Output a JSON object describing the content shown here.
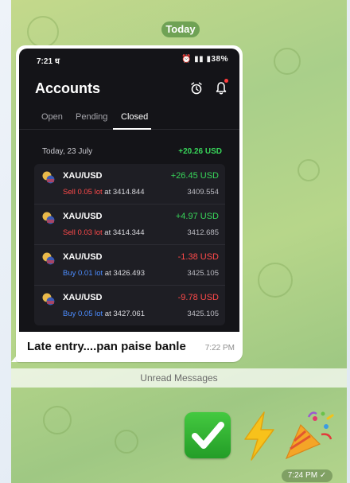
{
  "chat": {
    "date_label": "Today",
    "unread_label": "Unread Messages",
    "message": {
      "caption": "Late entry....pan paise banle",
      "time": "7:22 PM"
    },
    "emoji_message": {
      "emojis": [
        "check-mark-button",
        "high-voltage",
        "party-popper"
      ],
      "time": "7:24 PM",
      "status": "sent"
    }
  },
  "screenshot": {
    "status_bar": {
      "time": "7:21",
      "time_suffix": "ध",
      "battery": "38%"
    },
    "title": "Accounts",
    "tabs": [
      {
        "label": "Open",
        "active": false
      },
      {
        "label": "Pending",
        "active": false
      },
      {
        "label": "Closed",
        "active": true
      }
    ],
    "day": {
      "label": "Today, 23 July",
      "total": "+20.26 USD"
    },
    "trades": [
      {
        "symbol": "XAU/USD",
        "pnl": "+26.45 USD",
        "side": "Sell 0.05 lot",
        "at": " at 3414.844",
        "close": "3409.554",
        "sign": "pos"
      },
      {
        "symbol": "XAU/USD",
        "pnl": "+4.97 USD",
        "side": "Sell 0.03 lot",
        "at": " at 3414.344",
        "close": "3412.685",
        "sign": "pos"
      },
      {
        "symbol": "XAU/USD",
        "pnl": "-1.38 USD",
        "side": "Buy 0.01 lot",
        "at": " at 3426.493",
        "close": "3425.105",
        "sign": "neg"
      },
      {
        "symbol": "XAU/USD",
        "pnl": "-9.78 USD",
        "side": "Buy 0.05 lot",
        "at": " at 3427.061",
        "close": "3425.105",
        "sign": "neg"
      }
    ]
  },
  "colors": {
    "profit": "#38d65a",
    "loss": "#ff4a4a",
    "buy": "#4c8dff",
    "date_pill": "#6fa255"
  }
}
